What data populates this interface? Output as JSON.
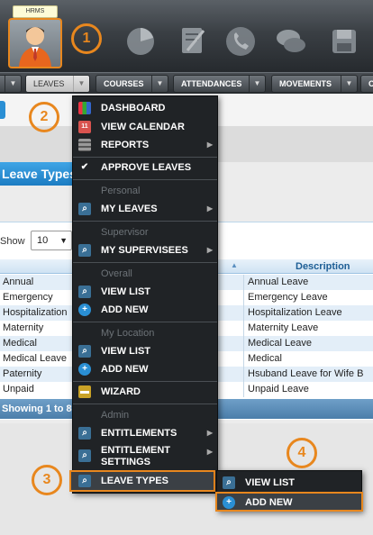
{
  "header": {
    "app_tag": "HRMS",
    "apps": [
      "hrms-avatar-icon",
      "pie-chart-icon",
      "document-icon",
      "phone-icon",
      "chat-bubbles-icon",
      "save-disk-icon"
    ]
  },
  "callouts": [
    "1",
    "2",
    "3",
    "4"
  ],
  "nav": {
    "leaves": "LEAVES",
    "courses": "COURSES",
    "attendances": "ATTENDANCES",
    "movements": "MOVEMENTS",
    "more": "C"
  },
  "page": {
    "title": "Leave Types",
    "show_label": "Show",
    "show_value": "10",
    "column_description": "Description",
    "footer_info": "Showing 1 to 8"
  },
  "table": {
    "rows": [
      {
        "name": "Annual",
        "description": "Annual Leave"
      },
      {
        "name": "Emergency",
        "description": "Emergency Leave"
      },
      {
        "name": "Hospitalization",
        "description": "Hospitalization Leave"
      },
      {
        "name": "Maternity",
        "description": "Maternity Leave"
      },
      {
        "name": "Medical",
        "description": "Medical Leave"
      },
      {
        "name": "Medical Leave",
        "description": "Medical"
      },
      {
        "name": "Paternity",
        "description": "Hsuband Leave for Wife B"
      },
      {
        "name": "Unpaid",
        "description": "Unpaid Leave"
      }
    ]
  },
  "menu": {
    "dashboard": "DASHBOARD",
    "view_calendar": "VIEW CALENDAR",
    "reports": "REPORTS",
    "approve_leaves": "APPROVE LEAVES",
    "personal_header": "Personal",
    "my_leaves": "MY LEAVES",
    "supervisor_header": "Supervisor",
    "my_supervisees": "MY SUPERVISEES",
    "overall_header": "Overall",
    "view_list": "VIEW LIST",
    "add_new": "ADD NEW",
    "my_location_header": "My Location",
    "view_list_2": "VIEW LIST",
    "add_new_2": "ADD NEW",
    "wizard": "WIZARD",
    "admin_header": "Admin",
    "entitlements": "ENTITLEMENTS",
    "entitlement_settings": "ENTITLEMENT SETTINGS",
    "leave_types": "LEAVE TYPES"
  },
  "flyout": {
    "view_list": "VIEW LIST",
    "add_new": "ADD NEW"
  },
  "colors": {
    "accent_orange": "#e8871e",
    "menu_bg": "#202326",
    "title_blue": "#1c7cc2"
  }
}
